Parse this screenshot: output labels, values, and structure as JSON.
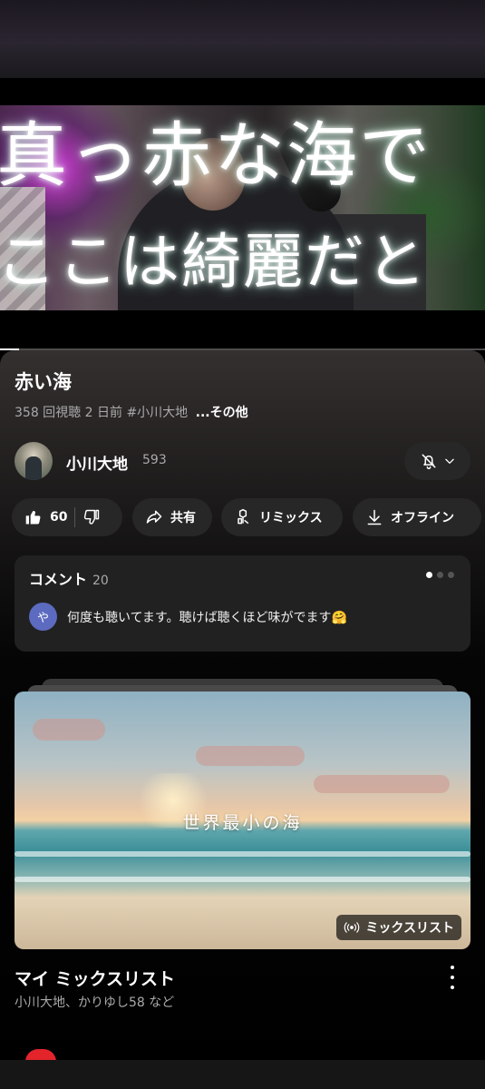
{
  "video": {
    "lyrics_line_1": "真っ赤な海で",
    "lyrics_line_2": "ここは綺麗だと",
    "progress": 0.04
  },
  "info": {
    "title": "赤い海",
    "views": "358 回視聴",
    "age": "2 日前",
    "hashtag": "#小川大地",
    "more": "...その他"
  },
  "channel": {
    "name": "小川大地",
    "subscribers": "593"
  },
  "actions": {
    "like_count": "60",
    "share_label": "共有",
    "remix_label": "リミックス",
    "offline_label": "オフライン"
  },
  "comments": {
    "header": "コメント",
    "count": "20",
    "avatar_initial": "や",
    "top_comment": "何度も聴いてます。聴けば聴くほど味がでます🤗"
  },
  "mix": {
    "thumbnail_text": "世界最小の海",
    "badge_label": "ミックスリスト",
    "title": "マイ ミックスリスト",
    "subtitle": "小川大地、かりゆし58 など"
  },
  "colors": {
    "background": "#000000",
    "pill": "#272727",
    "card": "#212121",
    "comment_avatar": "#5c6bc0",
    "accent_red": "#e3242b"
  }
}
